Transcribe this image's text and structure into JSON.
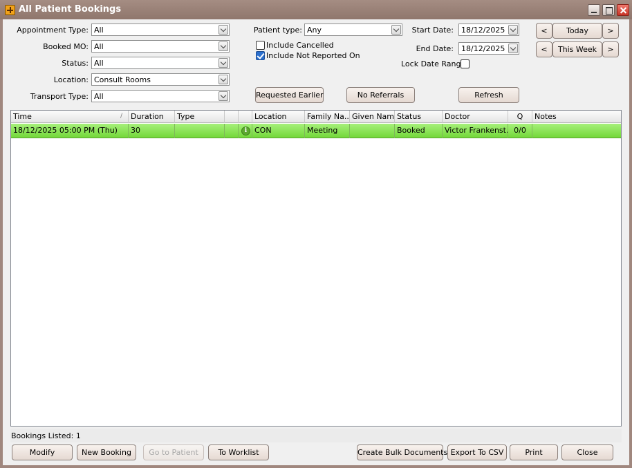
{
  "window": {
    "title": "All Patient Bookings"
  },
  "filters": {
    "appointment_type": {
      "label": "Appointment Type:",
      "value": "All"
    },
    "booked_mo": {
      "label": "Booked MO:",
      "value": "All"
    },
    "status": {
      "label": "Status:",
      "value": "All"
    },
    "location": {
      "label": "Location:",
      "value": "Consult Rooms"
    },
    "transport_type": {
      "label": "Transport Type:",
      "value": "All"
    },
    "patient_type": {
      "label": "Patient type:",
      "value": "Any"
    },
    "include_cancelled": {
      "label": "Include Cancelled",
      "checked": false
    },
    "include_not_reported": {
      "label": "Include Not Reported On",
      "checked": true
    },
    "start_date": {
      "label": "Start Date:",
      "value": "18/12/2025"
    },
    "end_date": {
      "label": "End Date:",
      "value": "18/12/2025"
    },
    "lock_date_range": {
      "label": "Lock Date Range",
      "checked": false
    }
  },
  "nav": {
    "prev": "<",
    "next": ">",
    "today": "Today",
    "this_week": "This Week"
  },
  "actions": {
    "requested_earlier": "Requested Earlier",
    "no_referrals": "No Referrals",
    "refresh": "Refresh"
  },
  "table": {
    "columns": [
      "Time",
      "Duration",
      "Type",
      "",
      "",
      "Location",
      "Family Na...",
      "Given Name",
      "Status",
      "Doctor",
      "Q",
      "Notes"
    ],
    "sort_indicator": "/",
    "rows": [
      {
        "time": "18/12/2025 05:00 PM (Thu)",
        "duration": "30",
        "type": "",
        "flag": "",
        "icon": "i",
        "location": "CON",
        "family_name": "Meeting",
        "given_name": "",
        "status": "Booked",
        "doctor": "Victor Frankenst...",
        "q": "0/0",
        "notes": "",
        "row_color": "#8de35a"
      }
    ]
  },
  "status_bar": {
    "text": "Bookings Listed: 1"
  },
  "footer": {
    "modify": "Modify",
    "new_booking": "New Booking",
    "go_to_patient": "Go to Patient",
    "to_worklist": "To Worklist",
    "create_bulk_documents": "Create Bulk Documents",
    "export_csv": "Export To CSV",
    "print": "Print",
    "close": "Close"
  }
}
